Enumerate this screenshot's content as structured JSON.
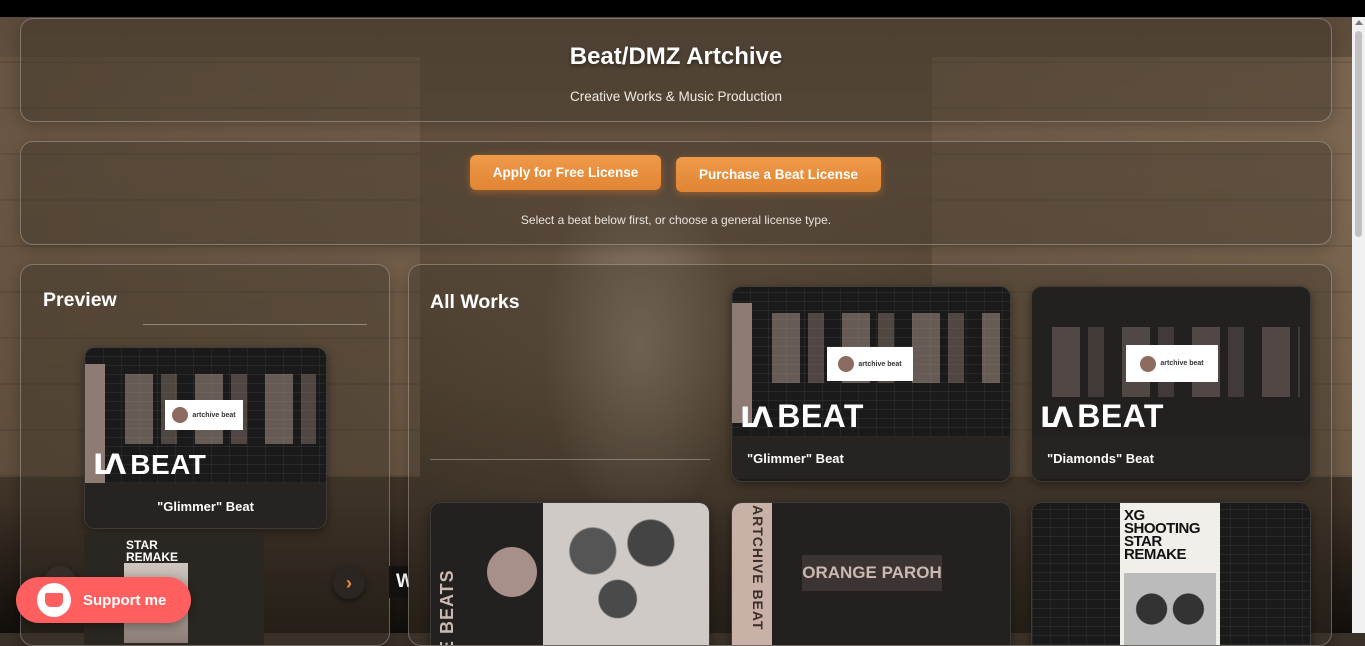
{
  "header": {
    "title": "Beat/DMZ Artchive",
    "subtitle": "Creative Works & Music Production"
  },
  "license": {
    "free_button": "Apply for Free License",
    "purchase_button": "Purchase a Beat License",
    "hint": "Select a beat below first, or choose a general license type."
  },
  "preview": {
    "heading": "Preview",
    "current_card": {
      "caption": "\"Glimmer\" Beat",
      "logo_text": "artchive beat",
      "beat_label": "BEAT",
      "beat_glyph": "ᒪᐱ"
    },
    "next_card_title": "STAR\nREMAKE",
    "next_icon": "chevron-right-icon"
  },
  "works": {
    "heading": "All Works",
    "cards": [
      {
        "caption": "\"Glimmer\" Beat",
        "logo_text": "artchive beat",
        "beat_label": "BEAT",
        "beat_glyph": "ᒪᐱ"
      },
      {
        "caption": "\"Diamonds\" Beat",
        "logo_text": "artchive beat",
        "beat_label": "BEAT",
        "beat_glyph": "ᒪᐱ"
      }
    ],
    "row2": {
      "poster1_text": "E BEATS",
      "poster2_title": "ORANGE PAROH",
      "poster2_side": "ARTCHIVE BEAT",
      "poster3_title": "XG SHOOTING STAR REMAKE"
    },
    "peek_letter": "W"
  },
  "support": {
    "label": "Support me",
    "icon": "ko-fi-cup-icon"
  },
  "colors": {
    "accent": "#e8893a",
    "support": "#ff5f5f"
  }
}
